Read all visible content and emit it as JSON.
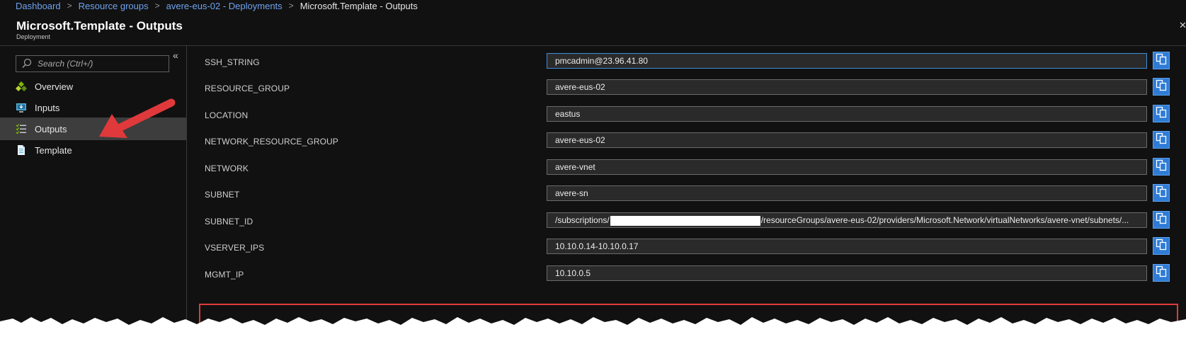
{
  "breadcrumb": {
    "items": [
      "Dashboard",
      "Resource groups",
      "avere-eus-02 - Deployments"
    ],
    "current": "Microsoft.Template - Outputs",
    "separator": ">"
  },
  "header": {
    "title": "Microsoft.Template - Outputs",
    "subtitle": "Deployment",
    "close_glyph": "✕"
  },
  "sidebar": {
    "search_placeholder": "Search (Ctrl+/)",
    "collapse_glyph": "«",
    "items": [
      {
        "label": "Overview",
        "icon": "overview-icon",
        "active": false
      },
      {
        "label": "Inputs",
        "icon": "inputs-icon",
        "active": false
      },
      {
        "label": "Outputs",
        "icon": "outputs-icon",
        "active": true
      },
      {
        "label": "Template",
        "icon": "template-icon",
        "active": false
      }
    ]
  },
  "outputs": [
    {
      "name": "SSH_STRING",
      "value": "pmcadmin@23.96.41.80"
    },
    {
      "name": "RESOURCE_GROUP",
      "value": "avere-eus-02"
    },
    {
      "name": "LOCATION",
      "value": "eastus"
    },
    {
      "name": "NETWORK_RESOURCE_GROUP",
      "value": "avere-eus-02"
    },
    {
      "name": "NETWORK",
      "value": "avere-vnet"
    },
    {
      "name": "SUBNET",
      "value": "avere-sn"
    },
    {
      "name": "SUBNET_ID",
      "value_prefix": "/subscriptions/",
      "value_suffix": "/resourceGroups/avere-eus-02/providers/Microsoft.Network/virtualNetworks/avere-vnet/subnets/..."
    },
    {
      "name": "VSERVER_IPS",
      "value": "10.10.0.14-10.10.0.17"
    },
    {
      "name": "MGMT_IP",
      "value": "10.10.0.5"
    }
  ],
  "colors": {
    "background": "#111111",
    "link": "#6fa3ef",
    "copy_button": "#2e7cd6",
    "highlight": "#e0393b",
    "active_nav": "#3d3d3d"
  }
}
